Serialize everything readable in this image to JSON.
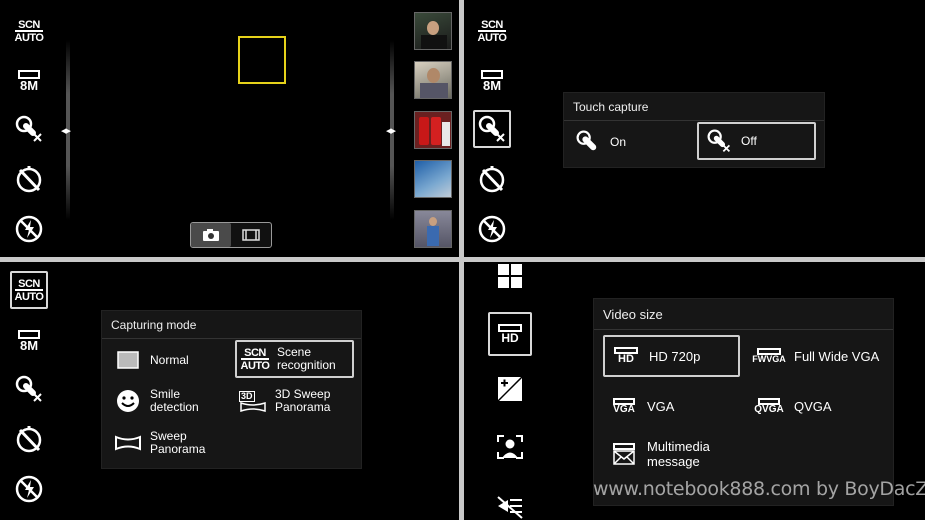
{
  "q1": {
    "left_icons": [
      "scene-auto-icon",
      "resolution-8m-icon",
      "touch-capture-icon",
      "self-timer-icon",
      "flash-icon"
    ],
    "scn": "SCN",
    "auto": "AUTO",
    "mp": "8M",
    "mode_buttons": [
      "camera-icon",
      "video-icon"
    ],
    "thumbnails": [
      {
        "name": "thumbnail-person-1",
        "colors": [
          "#3a4a3a",
          "#e8e8e8"
        ]
      },
      {
        "name": "thumbnail-person-2",
        "colors": [
          "#5a5a50",
          "#d8d0c0"
        ]
      },
      {
        "name": "thumbnail-cans",
        "colors": [
          "#b01010",
          "#e0e0e0"
        ]
      },
      {
        "name": "thumbnail-sky",
        "colors": [
          "#1f5fa8",
          "#b8c8d8"
        ]
      },
      {
        "name": "thumbnail-person-3",
        "colors": [
          "#666",
          "#9ab"
        ]
      }
    ]
  },
  "q2": {
    "panel_title": "Touch capture",
    "options": [
      {
        "label": "On",
        "icon": "touch-on-icon",
        "selected": false
      },
      {
        "label": "Off",
        "icon": "touch-off-icon",
        "selected": true
      }
    ],
    "scn": "SCN",
    "auto": "AUTO",
    "mp": "8M"
  },
  "q3": {
    "panel_title": "Capturing mode",
    "options": [
      {
        "label": "Normal",
        "icon": "normal-icon"
      },
      {
        "label": "Scene recognition",
        "icon": "scene-auto-icon"
      },
      {
        "label": "Smile detection",
        "icon": "smile-icon"
      },
      {
        "label": "3D Sweep Panorama",
        "icon": "3d-sweep-icon"
      },
      {
        "label": "Sweep Panorama",
        "icon": "sweep-panorama-icon"
      }
    ],
    "scn": "SCN",
    "auto": "AUTO",
    "mp": "8M",
    "scene_line1": "Scene",
    "scene_line2": "recognition",
    "smile_line1": "Smile",
    "smile_line2": "detection",
    "sweep3d_line1": "3D Sweep",
    "sweep3d_line2": "Panorama",
    "sweep_line1": "Sweep",
    "sweep_line2": "Panorama",
    "normal": "Normal",
    "badge_3d": "3D"
  },
  "q4": {
    "panel_title": "Video size",
    "options": [
      {
        "label": "HD 720p",
        "badge": "HD",
        "selected": true
      },
      {
        "label": "Full Wide VGA",
        "badge": "FWVGA",
        "selected": false
      },
      {
        "label": "VGA",
        "badge": "VGA",
        "selected": false
      },
      {
        "label": "QVGA",
        "badge": "QVGA",
        "selected": false
      },
      {
        "label": "Multimedia message",
        "badge": "",
        "selected": false
      }
    ],
    "mms_line1": "Multimedia",
    "mms_line2": "message",
    "left_hd": "HD",
    "watermark": "www.notebook888.com by BoyDacZ"
  }
}
